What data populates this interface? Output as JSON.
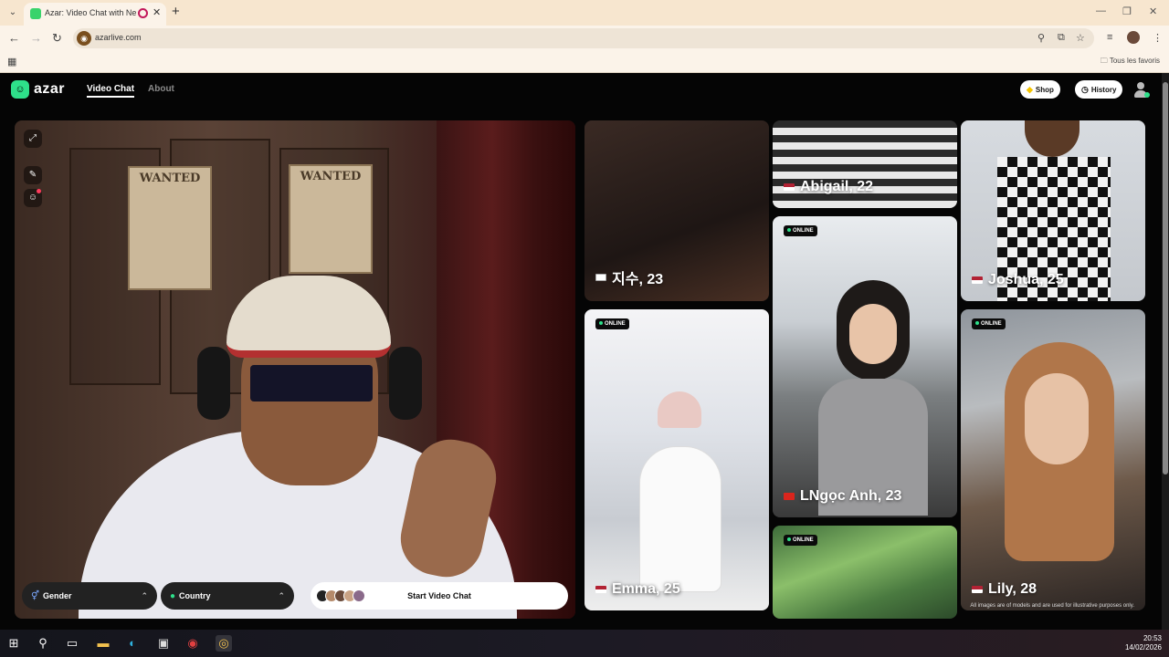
{
  "browser": {
    "tab_title": "Azar: Video Chat with New",
    "url": "azarlive.com",
    "bookmarks_folder": "Tous les favoris"
  },
  "nav": {
    "logo_text": "azar",
    "links": [
      "Video Chat",
      "About"
    ],
    "shop_label": "Shop",
    "history_label": "History"
  },
  "webcam": {
    "posters": [
      "WANTED",
      "WANTED"
    ]
  },
  "controls": {
    "gender_label": "Gender",
    "country_label": "Country",
    "start_label": "Start Video Chat"
  },
  "cards": [
    {
      "name": "지수, 23",
      "flag": "kr",
      "online": false
    },
    {
      "name": "Abigail, 22",
      "flag": "us",
      "online": false
    },
    {
      "name": "Joshua, 25",
      "flag": "us",
      "online": false
    },
    {
      "name": "LNgọc Anh, 23",
      "flag": "vn",
      "online": true,
      "online_label": "ONLINE"
    },
    {
      "name": "Emma, 25",
      "flag": "us",
      "online": true,
      "online_label": "ONLINE"
    },
    {
      "name": "Lily, 28",
      "flag": "us",
      "online": true,
      "online_label": "ONLINE"
    },
    {
      "name": "",
      "flag": "",
      "online": true,
      "online_label": "ONLINE"
    }
  ],
  "disclaimer": "All images are of models and are used for illustrative purposes only.",
  "taskbar": {
    "time": "20:53",
    "date": "14/02/2026"
  },
  "colors": {
    "brand_green": "#2ee08a",
    "page_bg": "#050505"
  }
}
